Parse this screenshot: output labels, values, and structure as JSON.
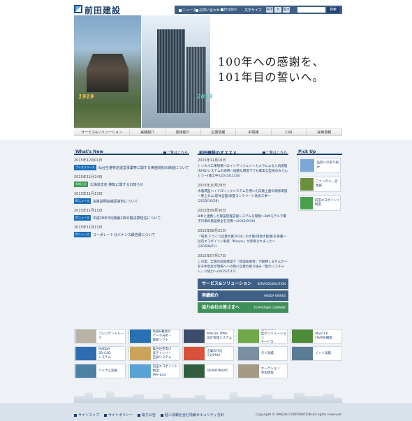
{
  "header": {
    "logo_text": "前田建設",
    "util_links": [
      "ニュース",
      "お問い合わせ",
      "English"
    ],
    "font_size_label": "文字サイズ",
    "font_sizes": [
      "標準",
      "大",
      "最大"
    ],
    "search_placeholder": "",
    "search_button": "検索"
  },
  "hero": {
    "copy_line1": "100年への感謝を、",
    "copy_line2": "101年目の誓いへ。",
    "year_left": "1919",
    "year_right": "2019"
  },
  "global_nav": [
    "サービス&ソリューション",
    "実績紹介",
    "技術紹介",
    "企業情報",
    "IR情報",
    "CSR",
    "採用情報"
  ],
  "whats_new": {
    "title": "What's New",
    "more": "一覧はこちら",
    "items": [
      {
        "date": "2015年12月01日",
        "badge": "プレスリリース",
        "badge_color": "#1d6fb8",
        "text": "仙台空港特定運営事業等に関する実施契約の締結について"
      },
      {
        "date": "2015年11月24日",
        "badge": "お知らせ",
        "badge_color": "#3a9c52",
        "text": "北海道支店 移転に関するお知らせ"
      },
      {
        "date": "2015年11月13日",
        "badge": "IRニュース",
        "badge_color": "#1d6fb8",
        "text": "決算説明会補足資料について"
      },
      {
        "date": "2015年11月11日",
        "badge": "IRニュース",
        "badge_color": "#1d6fb8",
        "text": "平成28年3月期第2四半期決算短信について"
      },
      {
        "date": "2015年11月11日",
        "badge": "IRニュース",
        "badge_color": "#1d6fb8",
        "text": "コーポレートガバナンス報告書について"
      }
    ]
  },
  "recommend": {
    "title": "前田建設のオススメ",
    "more": "一覧はこちら",
    "items": [
      {
        "date": "2015年11月16日",
        "text": "トンネル工事現場へのインテリジェントカメラによる入坑管理(RFID)システムの適用～過酷な環境下でも確実な監視のみてんとう～(施工中)(2015/11/16)"
      },
      {
        "date": "2015年10月28日",
        "text": "水循環型ハイドロリックシステムを用いた床版上面の補修実施～東上ダム(堤体全面)表面コンクリート改良工事～(2015/10/28)"
      },
      {
        "date": "2015年09月30日",
        "text": "BIMと連携した施設管理支援システムを開発～BIMモデルで電子行場の施設保全を活用～(2015/9/30)"
      },
      {
        "date": "2015年08月21日",
        "text": "『環境 人づくり企業大賞2014』の大賞(環境大臣賞)を受賞～社内エコポイント制度「Mecpo」が評価されました～(2015/8/21)"
      },
      {
        "date": "2015年07月17日",
        "text": "この度、全国の前田建設で『建設技術者』が勤務しませんか～女子中高生が現場へ～の際に企業の取り組み「夏のリコチャレ」に協力～(2015/7/17)"
      }
    ],
    "banners": [
      {
        "label": "サービス&ソリューション",
        "sub": "SERVICE&SOLUTION",
        "color": "#3e5f86"
      },
      {
        "label": "実績紹介",
        "sub": "MAEDA WORKS",
        "color": "#3e5f86"
      },
      {
        "label": "協力会社の皆さまへ",
        "sub": "TO PARTNER COMPANY",
        "color": "#3f8f5b"
      }
    ]
  },
  "pickup": {
    "title": "Pick Up",
    "items": [
      {
        "label": "品質への取り組み",
        "color": "#7ea7d8"
      },
      {
        "label": "ファンタジー営業部",
        "color": "#6b8f3e"
      },
      {
        "label": "前田エコポイント制度",
        "color": "#4a9f4f"
      }
    ]
  },
  "banner_grid": [
    {
      "label": "プレジデントトーク",
      "color": "#b9b2a6"
    },
    {
      "label": "高速&難易な\nデータ分析・\n探索ソフト",
      "color": "#2a6fb4"
    },
    {
      "label": "MAEDA TPMs\n設計管理システム",
      "color": "#3b4d6a"
    },
    {
      "label": "省エネルギー\n型のソリューション\nサービス",
      "color": "#6fa94a"
    },
    {
      "label": "MaSTER\nFRAME構築",
      "color": "#4f8a3b"
    },
    {
      "label": "MAEDA\n3D-CAD\nシステム",
      "color": "#2e6bb1"
    },
    {
      "label": "集合住宅向け\n床チャンバー\n空調システム",
      "color": "#c9a45a"
    },
    {
      "label": "企業のIT化\nえむPRIX",
      "color": "#d9513a"
    },
    {
      "label": "タイ実績",
      "color": "#7a8fa3"
    },
    {
      "label": "インド実績",
      "color": "#5c7c96"
    },
    {
      "label": "ベトナム実績",
      "color": "#4e7fa5"
    },
    {
      "label": "前田エコポイント\n制度\n(Me-pos)",
      "color": "#59a2d6"
    },
    {
      "label": "DEPARTMENT",
      "color": "#2f5f3f"
    },
    {
      "label": "オークション\n参加登録",
      "color": "#a59a84"
    },
    {
      "label": "",
      "color": "#ffffff"
    }
  ],
  "footer": {
    "links": [
      "サイトマップ",
      "サイトポリシー",
      "電子公告",
      "個人情報を含む情報セキュリティ方針"
    ],
    "copyright": "Copyright © MAEDA CORPORATION All rights reserved."
  }
}
